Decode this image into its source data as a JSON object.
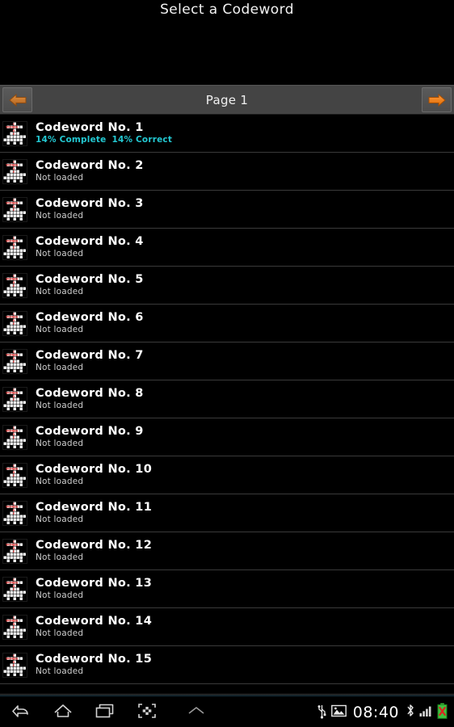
{
  "header": {
    "title": "Select a Codeword"
  },
  "pager": {
    "label": "Page 1",
    "prev_icon": "arrow-left-icon",
    "next_icon": "arrow-right-icon",
    "prev_color": "#c2712b",
    "next_color": "#f07d16"
  },
  "list": {
    "icon_name": "codeword-puzzle-icon",
    "progress_color": "#23c8d2",
    "items": [
      {
        "title": "Codeword No. 1",
        "status": "",
        "complete": "14% Complete",
        "correct": "14% Correct",
        "loaded": true
      },
      {
        "title": "Codeword No. 2",
        "status": "Not loaded",
        "loaded": false
      },
      {
        "title": "Codeword No. 3",
        "status": "Not loaded",
        "loaded": false
      },
      {
        "title": "Codeword No. 4",
        "status": "Not loaded",
        "loaded": false
      },
      {
        "title": "Codeword No. 5",
        "status": "Not loaded",
        "loaded": false
      },
      {
        "title": "Codeword No. 6",
        "status": "Not loaded",
        "loaded": false
      },
      {
        "title": "Codeword No. 7",
        "status": "Not loaded",
        "loaded": false
      },
      {
        "title": "Codeword No. 8",
        "status": "Not loaded",
        "loaded": false
      },
      {
        "title": "Codeword No. 9",
        "status": "Not loaded",
        "loaded": false
      },
      {
        "title": "Codeword No. 10",
        "status": "Not loaded",
        "loaded": false
      },
      {
        "title": "Codeword No. 11",
        "status": "Not loaded",
        "loaded": false
      },
      {
        "title": "Codeword No. 12",
        "status": "Not loaded",
        "loaded": false
      },
      {
        "title": "Codeword No. 13",
        "status": "Not loaded",
        "loaded": false
      },
      {
        "title": "Codeword No. 14",
        "status": "Not loaded",
        "loaded": false
      },
      {
        "title": "Codeword No. 15",
        "status": "Not loaded",
        "loaded": false
      }
    ]
  },
  "systembar": {
    "buttons": [
      {
        "name": "back-icon"
      },
      {
        "name": "home-icon"
      },
      {
        "name": "recents-icon"
      },
      {
        "name": "screenshot-icon"
      },
      {
        "name": "chevron-up-icon"
      }
    ],
    "status": {
      "usb_icon": "usb-icon",
      "image_icon": "image-icon",
      "time": "08:40",
      "bluetooth_icon": "bluetooth-icon",
      "signal_icon": "signal-bars-icon",
      "battery_icon": "battery-error-icon"
    }
  }
}
